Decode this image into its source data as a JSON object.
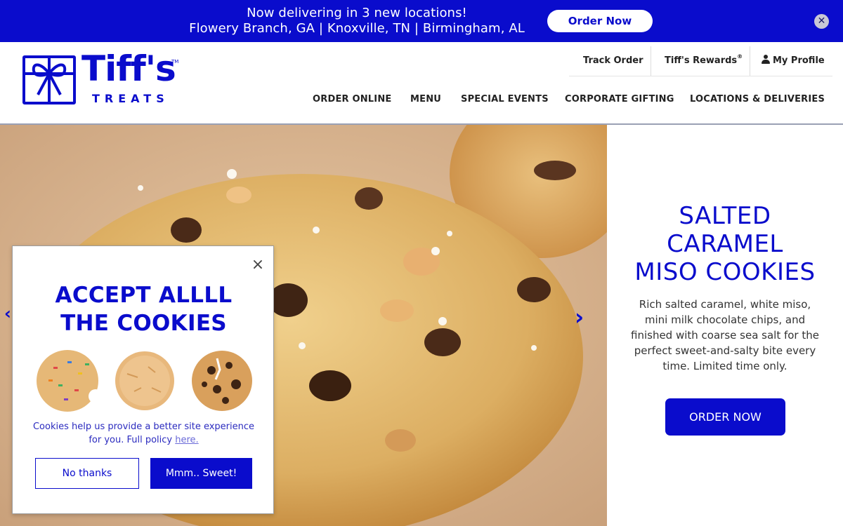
{
  "promo_banner": {
    "line1": "Now delivering in 3 new locations!",
    "line2": "Flowery Branch, GA | Knoxville, TN | Birmingham, AL",
    "cta": "Order Now",
    "close_icon": "close-icon"
  },
  "header": {
    "logo": {
      "name": "Tiff's",
      "tm": "TM",
      "sub": "TREATS"
    },
    "utility": {
      "track_order": "Track Order",
      "rewards": "Tiff's Rewards",
      "rewards_mark": "®",
      "profile": "My Profile"
    },
    "nav": [
      "ORDER ONLINE",
      "MENU",
      "SPECIAL EVENTS",
      "CORPORATE GIFTING",
      "LOCATIONS & DELIVERIES"
    ]
  },
  "hero": {
    "title_lines": [
      "SALTED",
      "CARAMEL",
      "MISO COOKIES"
    ],
    "description": "Rich salted caramel, white miso, mini milk chocolate chips, and finished with coarse sea salt for the perfect sweet-and-salty bite every time. Limited time only.",
    "cta": "ORDER NOW"
  },
  "cookie_modal": {
    "title_line1": "ACCEPT ALLLL",
    "title_line2": "THE COOKIES",
    "text": "Cookies help us provide a better site experience for you. Full policy",
    "link": "here.",
    "decline": "No thanks",
    "accept": "Mmm.. Sweet!"
  },
  "colors": {
    "brand_blue": "#0a0ccc",
    "cookie_tan": "#d9a96f"
  }
}
